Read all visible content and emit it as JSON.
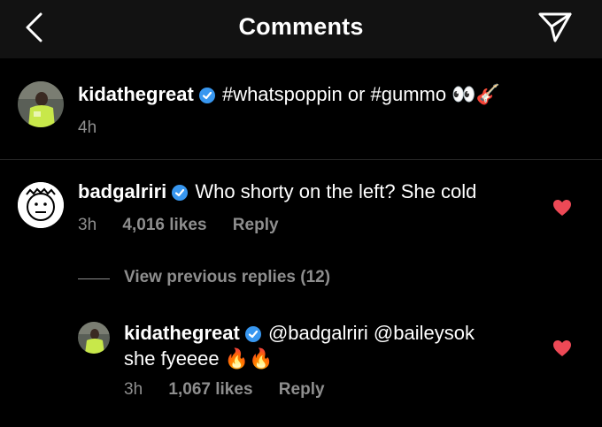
{
  "header": {
    "title": "Comments",
    "back_icon": "chevron-left-icon",
    "send_icon": "paper-plane-icon"
  },
  "caption": {
    "username": "kidathegreat",
    "text": "#whatspoppin or #gummo",
    "emojis": "👀🎸",
    "time": "4h"
  },
  "comments": [
    {
      "username": "badgalriri",
      "text": "Who shorty on the left? She cold",
      "time": "3h",
      "likes": "4,016 likes",
      "reply": "Reply"
    }
  ],
  "view_previous": "View previous replies (12)",
  "reply": {
    "username": "kidathegreat",
    "text_line1": "@badgalriri @baileysok",
    "text_line2": "she fyeeee",
    "emojis": "🔥🔥",
    "time": "3h",
    "likes": "1,067 likes",
    "reply": "Reply"
  },
  "colors": {
    "background": "#000000",
    "header_bg": "#121212",
    "secondary_text": "#8e8e8e",
    "verified_blue": "#3897f0",
    "heart_red": "#ed4956"
  }
}
